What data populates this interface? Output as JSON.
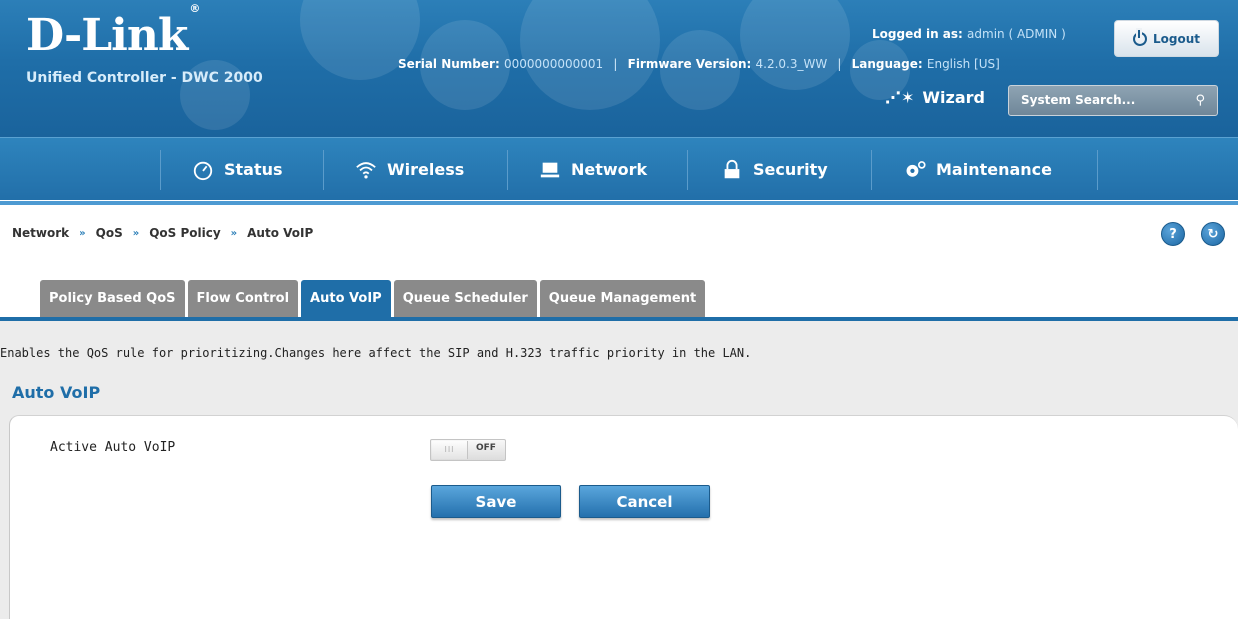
{
  "header": {
    "logo": "D-Link",
    "logo_mark": "®",
    "product": "Unified Controller - DWC 2000",
    "serial_label": "Serial Number:",
    "serial_value": "0000000000001",
    "firmware_label": "Firmware Version:",
    "firmware_value": "4.2.0.3_WW",
    "language_label": "Language:",
    "language_value": "English [US]",
    "logged_label": "Logged in as:",
    "logged_value": "admin ( ADMIN )",
    "logout_label": "Logout",
    "wizard_label": "Wizard",
    "search_placeholder": "System Search..."
  },
  "nav": {
    "items": [
      {
        "label": "Status",
        "icon": "gauge-icon"
      },
      {
        "label": "Wireless",
        "icon": "wifi-icon"
      },
      {
        "label": "Network",
        "icon": "computer-icon"
      },
      {
        "label": "Security",
        "icon": "lock-icon"
      },
      {
        "label": "Maintenance",
        "icon": "gears-icon"
      }
    ]
  },
  "breadcrumb": [
    "Network",
    "QoS",
    "QoS Policy",
    "Auto VoIP"
  ],
  "breadcrumb_sep": "»",
  "tabs": [
    "Policy Based QoS",
    "Flow Control",
    "Auto VoIP",
    "Queue Scheduler",
    "Queue Management"
  ],
  "active_tab": "Auto VoIP",
  "description": "Enables the QoS rule for prioritizing.Changes here affect the SIP and H.323 traffic priority in the LAN.",
  "section_title": "Auto VoIP",
  "form": {
    "field_label": "Active Auto VoIP",
    "toggle_state": "OFF",
    "toggle_knob": "III",
    "save_label": "Save",
    "cancel_label": "Cancel"
  },
  "colors": {
    "brand_blue": "#1f6ea8",
    "tab_inactive": "#8a8a8a"
  }
}
